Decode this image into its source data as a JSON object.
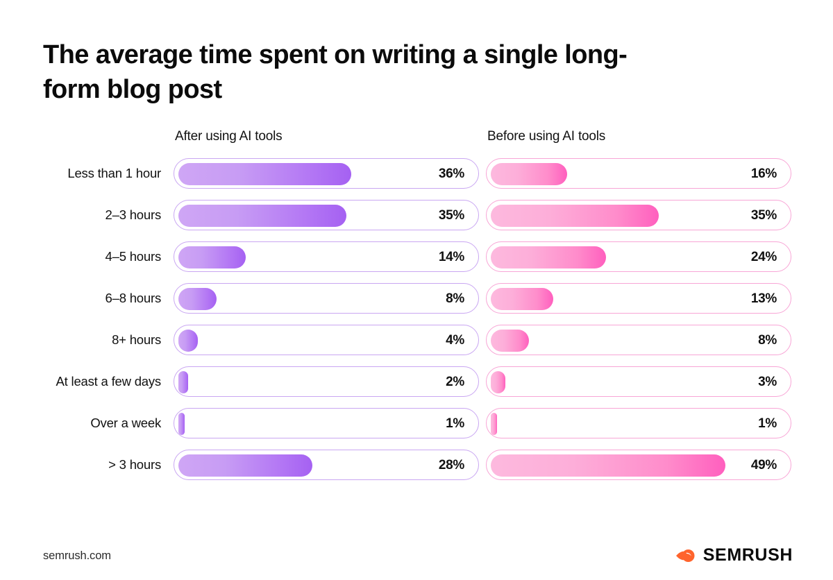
{
  "title": "The average time spent on writing a single long-form blog post",
  "footer": {
    "url": "semrush.com",
    "brand_name": "SEMRUSH",
    "brand_icon": "semrush-comet-icon",
    "brand_color": "#ff642d"
  },
  "colors": {
    "purple_track_border": "#c9a6f2",
    "purple_fill_start": "#cfa6f5",
    "purple_fill_end": "#a561f2",
    "pink_track_border": "#f8a5d6",
    "pink_fill_start": "#fdb9de",
    "pink_fill_end": "#ff5fbe",
    "text": "#111111",
    "background": "#ffffff"
  },
  "chart_data": {
    "type": "bar",
    "title": "The average time spent on writing a single long-form blog post",
    "xlabel": "",
    "ylabel": "",
    "xlim": [
      0,
      62
    ],
    "grid": false,
    "legend_position": "top-column-headers",
    "value_suffix": "%",
    "categories": [
      "Less than 1 hour",
      "2–3 hours",
      "4–5 hours",
      "6–8 hours",
      "8+ hours",
      "At least a few days",
      "Over a week",
      "> 3 hours"
    ],
    "series": [
      {
        "name": "After using AI tools",
        "color": "#a561f2",
        "values": [
          36,
          35,
          14,
          8,
          4,
          2,
          1,
          28
        ],
        "labels": [
          "36%",
          "35%",
          "14%",
          "8%",
          "4%",
          "2%",
          "1%",
          "28%"
        ]
      },
      {
        "name": "Before using AI tools",
        "color": "#ff5fbe",
        "values": [
          16,
          35,
          24,
          13,
          8,
          3,
          1,
          49
        ],
        "labels": [
          "16%",
          "35%",
          "24%",
          "13%",
          "8%",
          "3%",
          "1%",
          "49%"
        ]
      }
    ]
  }
}
